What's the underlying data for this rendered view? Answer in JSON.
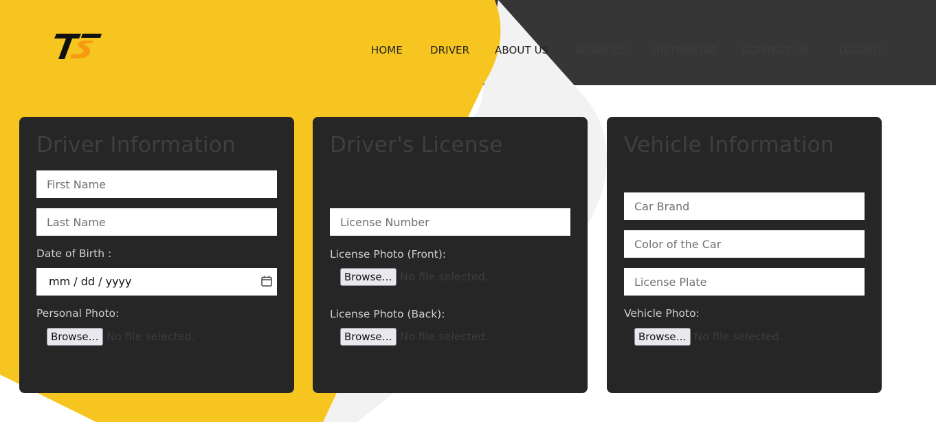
{
  "nav": {
    "items": [
      "HOME",
      "DRIVER",
      "ABOUT US",
      "SERVICES",
      "HISTORIQUE",
      "CONTACT US",
      "LOGOUT"
    ]
  },
  "driver": {
    "title": "Driver Information",
    "first_name_placeholder": "First Name",
    "last_name_placeholder": "Last Name",
    "dob_label": "Date of Birth :",
    "dob_value": "mm / dd / yyyy",
    "photo_label": "Personal Photo:",
    "browse_label": "Browse…",
    "no_file": "No file selected."
  },
  "license": {
    "title": "Driver's License",
    "number_placeholder": "License Number",
    "front_label": "License Photo (Front):",
    "back_label": "License Photo (Back):",
    "browse_label": "Browse…",
    "no_file": "No file selected."
  },
  "vehicle": {
    "title": "Vehicle Information",
    "brand_placeholder": "Car Brand",
    "color_placeholder": "Color of the Car",
    "plate_placeholder": "License Plate",
    "photo_label": "Vehicle Photo:",
    "browse_label": "Browse…",
    "no_file": "No file selected."
  },
  "colors": {
    "accent": "#f6c520",
    "header_dark": "#363636",
    "card": "#262626",
    "light_blob": "#f2f2f2"
  }
}
